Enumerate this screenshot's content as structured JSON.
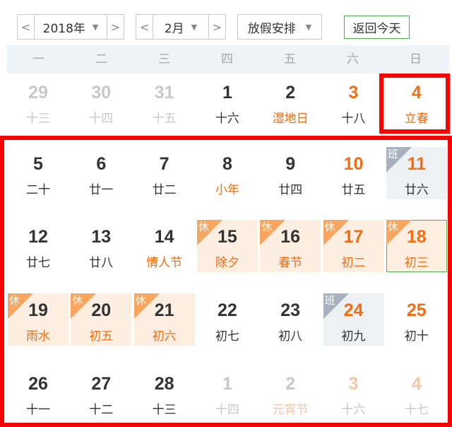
{
  "toolbar": {
    "year": {
      "prev": "<",
      "value": "2018年",
      "caret": "▼",
      "next": ">"
    },
    "month": {
      "prev": "<",
      "value": "2月",
      "caret": "▼",
      "next": ">"
    },
    "holiday": {
      "value": "放假安排",
      "caret": "▼"
    },
    "today_button": "返回今天"
  },
  "weekdays": [
    "一",
    "二",
    "三",
    "四",
    "五",
    "六",
    "日"
  ],
  "badges": {
    "rest": "休",
    "work": "班"
  },
  "colors": {
    "accent": "#f56d10",
    "rest_bg": "#fdeee2",
    "work_bg": "#eef1f4",
    "today_border": "#4caf50",
    "highlight": "#ff0000"
  },
  "weeks": [
    [
      {
        "day": "29",
        "lunar": "十三",
        "other": true
      },
      {
        "day": "30",
        "lunar": "十四",
        "other": true
      },
      {
        "day": "31",
        "lunar": "十五",
        "other": true
      },
      {
        "day": "1",
        "lunar": "十六"
      },
      {
        "day": "2",
        "lunar": "湿地日",
        "festival": true
      },
      {
        "day": "3",
        "lunar": "十八",
        "weekend": true
      },
      {
        "day": "4",
        "lunar": "立春",
        "weekend": true,
        "festival": true
      }
    ],
    [
      {
        "day": "5",
        "lunar": "二十"
      },
      {
        "day": "6",
        "lunar": "廿一"
      },
      {
        "day": "7",
        "lunar": "廿二"
      },
      {
        "day": "8",
        "lunar": "小年",
        "festival": true
      },
      {
        "day": "9",
        "lunar": "廿四"
      },
      {
        "day": "10",
        "lunar": "廿五",
        "weekend": true
      },
      {
        "day": "11",
        "lunar": "廿六",
        "weekend": true,
        "status": "work"
      }
    ],
    [
      {
        "day": "12",
        "lunar": "廿七"
      },
      {
        "day": "13",
        "lunar": "廿八"
      },
      {
        "day": "14",
        "lunar": "情人节",
        "festival": true
      },
      {
        "day": "15",
        "lunar": "除夕",
        "status": "rest"
      },
      {
        "day": "16",
        "lunar": "春节",
        "status": "rest"
      },
      {
        "day": "17",
        "lunar": "初二",
        "weekend": true,
        "status": "rest"
      },
      {
        "day": "18",
        "lunar": "初三",
        "weekend": true,
        "status": "rest",
        "today": true
      }
    ],
    [
      {
        "day": "19",
        "lunar": "雨水",
        "status": "rest"
      },
      {
        "day": "20",
        "lunar": "初五",
        "status": "rest"
      },
      {
        "day": "21",
        "lunar": "初六",
        "status": "rest"
      },
      {
        "day": "22",
        "lunar": "初七"
      },
      {
        "day": "23",
        "lunar": "初八"
      },
      {
        "day": "24",
        "lunar": "初九",
        "weekend": true,
        "status": "work"
      },
      {
        "day": "25",
        "lunar": "初十",
        "weekend": true
      }
    ],
    [
      {
        "day": "26",
        "lunar": "十一"
      },
      {
        "day": "27",
        "lunar": "十二"
      },
      {
        "day": "28",
        "lunar": "十三"
      },
      {
        "day": "1",
        "lunar": "十四",
        "other": true
      },
      {
        "day": "2",
        "lunar": "元宵节",
        "other": true,
        "festival": true
      },
      {
        "day": "3",
        "lunar": "十六",
        "other": true,
        "weekend": true
      },
      {
        "day": "4",
        "lunar": "十七",
        "other": true,
        "weekend": true
      }
    ]
  ]
}
